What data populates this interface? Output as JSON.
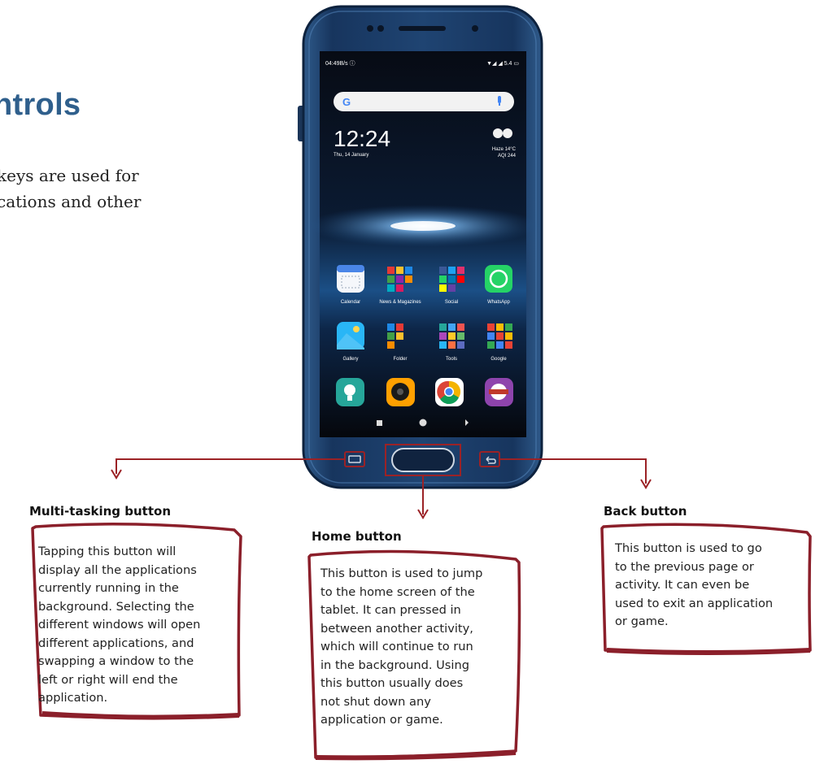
{
  "heading": "ntrols",
  "intro": "keys are used for\ncations and other",
  "phone": {
    "status_left": "04:49B/s ⓘ",
    "status_right": "▼◢ ◢ 5.4 ▭",
    "search_logo": "G",
    "clock": "12:24",
    "date": "Thu, 14 January",
    "weather_line1": "Haze  14°C",
    "weather_line2": "AQI 244",
    "apps_row1": [
      "Calendar",
      "News & Magazines",
      "Social",
      "WhatsApp"
    ],
    "apps_row2": [
      "Gallery",
      "Folder",
      "Tools",
      "Google"
    ]
  },
  "callouts": {
    "multitask": {
      "title": "Multi-tasking button",
      "lines": [
        "Tapping this button will",
        "display all the applications",
        "currently running in the",
        "background. Selecting the",
        "different windows will open",
        "different applications, and",
        "swapping a window to the",
        "left or right will end the",
        "application."
      ]
    },
    "home": {
      "title": "Home button",
      "lines": [
        "This button is used to jump",
        "to the home screen of the",
        "tablet. It can pressed in",
        "between another activity,",
        "which will continue to run",
        "in the background. Using",
        "this button usually does",
        "not shut down any",
        "application or game."
      ]
    },
    "back": {
      "title": "Back button",
      "lines": [
        "This button is used to go",
        "to the previous page or",
        "activity. It can even be",
        "used to exit an application",
        "or game."
      ]
    }
  },
  "colors": {
    "heading": "#2f5f8c",
    "accent_red": "#9b2226",
    "phone_body": "#1d3f6e"
  }
}
